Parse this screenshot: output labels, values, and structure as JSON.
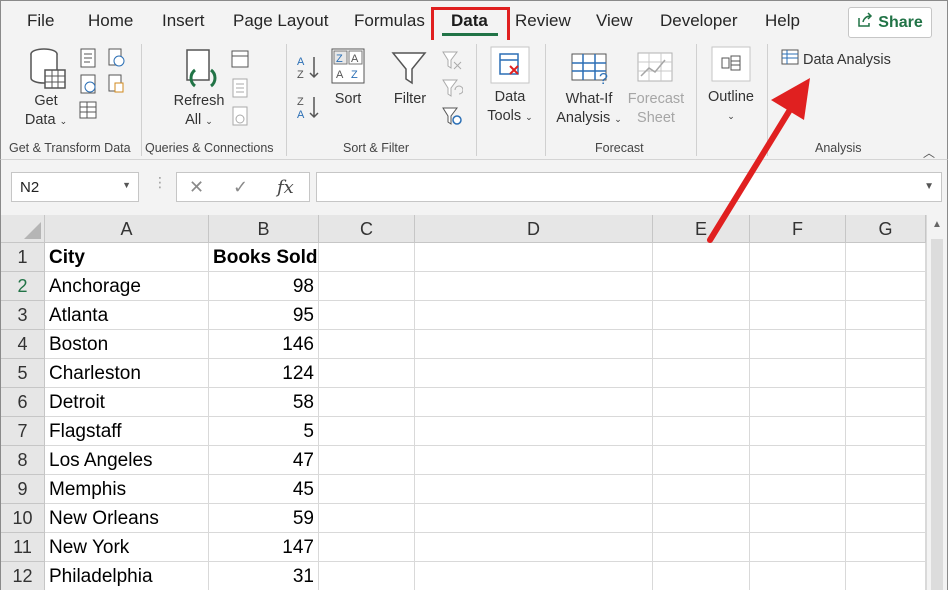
{
  "menu": {
    "tabs": [
      "File",
      "Home",
      "Insert",
      "Page Layout",
      "Formulas",
      "Data",
      "Review",
      "View",
      "Developer",
      "Help"
    ],
    "active_tab": "Data",
    "share_label": "Share"
  },
  "ribbon": {
    "get_data_line1": "Get",
    "get_data_line2": "Data",
    "refresh_line1": "Refresh",
    "refresh_line2": "All",
    "sort_label": "Sort",
    "filter_label": "Filter",
    "data_tools_line1": "Data",
    "data_tools_line2": "Tools",
    "whatif_line1": "What-If",
    "whatif_line2": "Analysis",
    "forecast_line1": "Forecast",
    "forecast_line2": "Sheet",
    "outline_label": "Outline",
    "data_analysis_label": "Data Analysis",
    "groups": {
      "get_transform": "Get & Transform Data",
      "queries": "Queries & Connections",
      "sort_filter": "Sort & Filter",
      "forecast": "Forecast",
      "analysis": "Analysis"
    }
  },
  "formula_bar": {
    "name_box": "N2",
    "cancel_symbol": "✕",
    "enter_symbol": "✓",
    "fx_symbol": "fx",
    "formula": ""
  },
  "grid": {
    "columns": [
      "A",
      "B",
      "C",
      "D",
      "E",
      "F",
      "G"
    ],
    "row_numbers": [
      "1",
      "2",
      "3",
      "4",
      "5",
      "6",
      "7",
      "8",
      "9",
      "10",
      "11",
      "12"
    ],
    "selected_row": "2",
    "header": {
      "city": "City",
      "books": "Books Sold"
    },
    "rows": [
      {
        "city": "Anchorage",
        "books": "98"
      },
      {
        "city": "Atlanta",
        "books": "95"
      },
      {
        "city": "Boston",
        "books": "146"
      },
      {
        "city": "Charleston",
        "books": "124"
      },
      {
        "city": "Detroit",
        "books": "58"
      },
      {
        "city": "Flagstaff",
        "books": "5"
      },
      {
        "city": "Los Angeles",
        "books": "47"
      },
      {
        "city": "Memphis",
        "books": "45"
      },
      {
        "city": "New Orleans",
        "books": "59"
      },
      {
        "city": "New York",
        "books": "147"
      },
      {
        "city": "Philadelphia",
        "books": "31"
      }
    ]
  },
  "colors": {
    "accent_green": "#217346",
    "annotation_red": "#e02020"
  }
}
